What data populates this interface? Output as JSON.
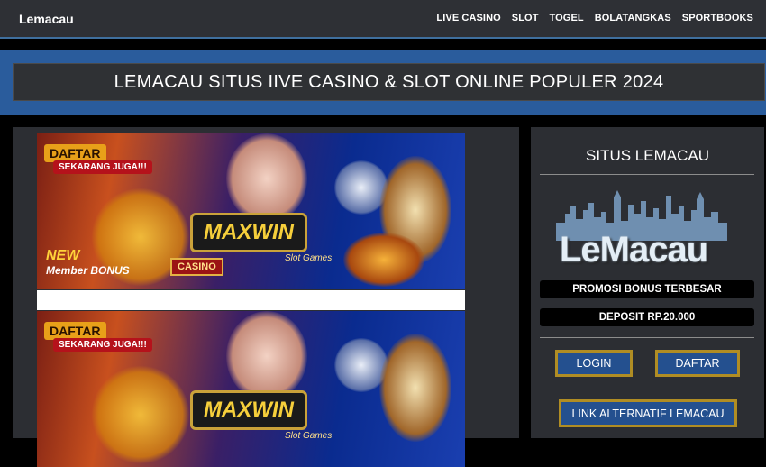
{
  "header": {
    "brand": "Lemacau",
    "nav": [
      "LIVE CASINO",
      "SLOT",
      "TOGEL",
      "BOLATANGKAS",
      "SPORTBOOKS"
    ]
  },
  "hero": {
    "title": "LEMACAU SITUS IIVE CASINO & SLOT ONLINE POPULER 2024"
  },
  "banner": {
    "daftar": "DAFTAR",
    "sekarang": "SEKARANG JUGA!!!",
    "maxwin": "MAXWIN",
    "casino": "CASINO",
    "slot_games": "Slot Games",
    "new_member": "NEW",
    "member_bonus": "Member BONUS"
  },
  "sidebar": {
    "title": "SITUS LEMACAU",
    "logo_text": "LeMacau",
    "promo": "PROMOSI BONUS TERBESAR",
    "deposit": "DEPOSIT RP.20.000",
    "login": "LOGIN",
    "daftar": "DAFTAR",
    "alt_link": "LINK ALTERNATIF LEMACAU"
  },
  "colors": {
    "accent": "#2a5c9c",
    "button": "#24508f",
    "button_border": "#b08d24",
    "panel": "#2c2e33"
  }
}
